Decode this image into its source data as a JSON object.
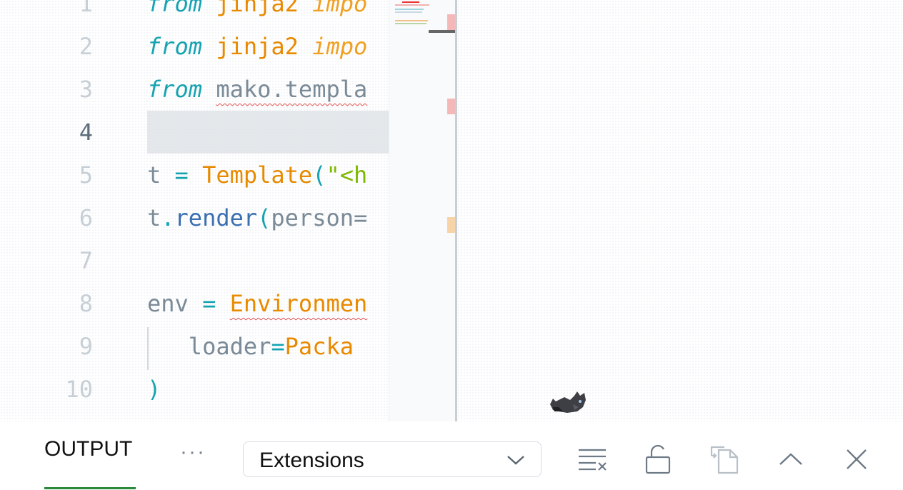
{
  "editor": {
    "line_numbers": [
      "1",
      "2",
      "3",
      "4",
      "5",
      "6",
      "7",
      "8",
      "9",
      "10"
    ],
    "active_line": "4",
    "lines": [
      {
        "tokens": [
          {
            "t": "from",
            "c": "kw"
          },
          {
            "t": " ",
            "c": "plain"
          },
          {
            "t": "jinja2",
            "c": "mod"
          },
          {
            "t": " ",
            "c": "plain"
          },
          {
            "t": "impo",
            "c": "imp"
          }
        ]
      },
      {
        "tokens": [
          {
            "t": "from",
            "c": "kw"
          },
          {
            "t": " ",
            "c": "plain"
          },
          {
            "t": "jinja2",
            "c": "mod"
          },
          {
            "t": " ",
            "c": "plain"
          },
          {
            "t": "impo",
            "c": "imp"
          }
        ]
      },
      {
        "tokens": [
          {
            "t": "from",
            "c": "kw"
          },
          {
            "t": " ",
            "c": "plain"
          },
          {
            "t": "mako.templa",
            "c": "plain squiggle"
          }
        ]
      },
      {
        "tokens": []
      },
      {
        "tokens": [
          {
            "t": "t",
            "c": "plain"
          },
          {
            "t": " = ",
            "c": "op"
          },
          {
            "t": "Template",
            "c": "cls"
          },
          {
            "t": "(",
            "c": "op"
          },
          {
            "t": "\"<h",
            "c": "str"
          }
        ]
      },
      {
        "tokens": [
          {
            "t": "t",
            "c": "plain"
          },
          {
            "t": ".",
            "c": "op"
          },
          {
            "t": "render",
            "c": "fn"
          },
          {
            "t": "(",
            "c": "op"
          },
          {
            "t": "person=",
            "c": "plain"
          }
        ]
      },
      {
        "tokens": []
      },
      {
        "tokens": [
          {
            "t": "env",
            "c": "plain"
          },
          {
            "t": " = ",
            "c": "op"
          },
          {
            "t": "Environmen",
            "c": "cls squiggle"
          }
        ]
      },
      {
        "tokens": [
          {
            "t": "   loader",
            "c": "plain"
          },
          {
            "t": "=",
            "c": "op"
          },
          {
            "t": "Packa",
            "c": "cls"
          }
        ]
      },
      {
        "tokens": [
          {
            "t": ")",
            "c": "op"
          }
        ]
      }
    ]
  },
  "panel": {
    "tab_label": "OUTPUT",
    "more_label": "···",
    "channel_select": "Extensions"
  },
  "colors": {
    "accent": "#2a8a3a",
    "error": "#e05050",
    "keyword": "#15a3b1",
    "class": "#e88a00"
  }
}
